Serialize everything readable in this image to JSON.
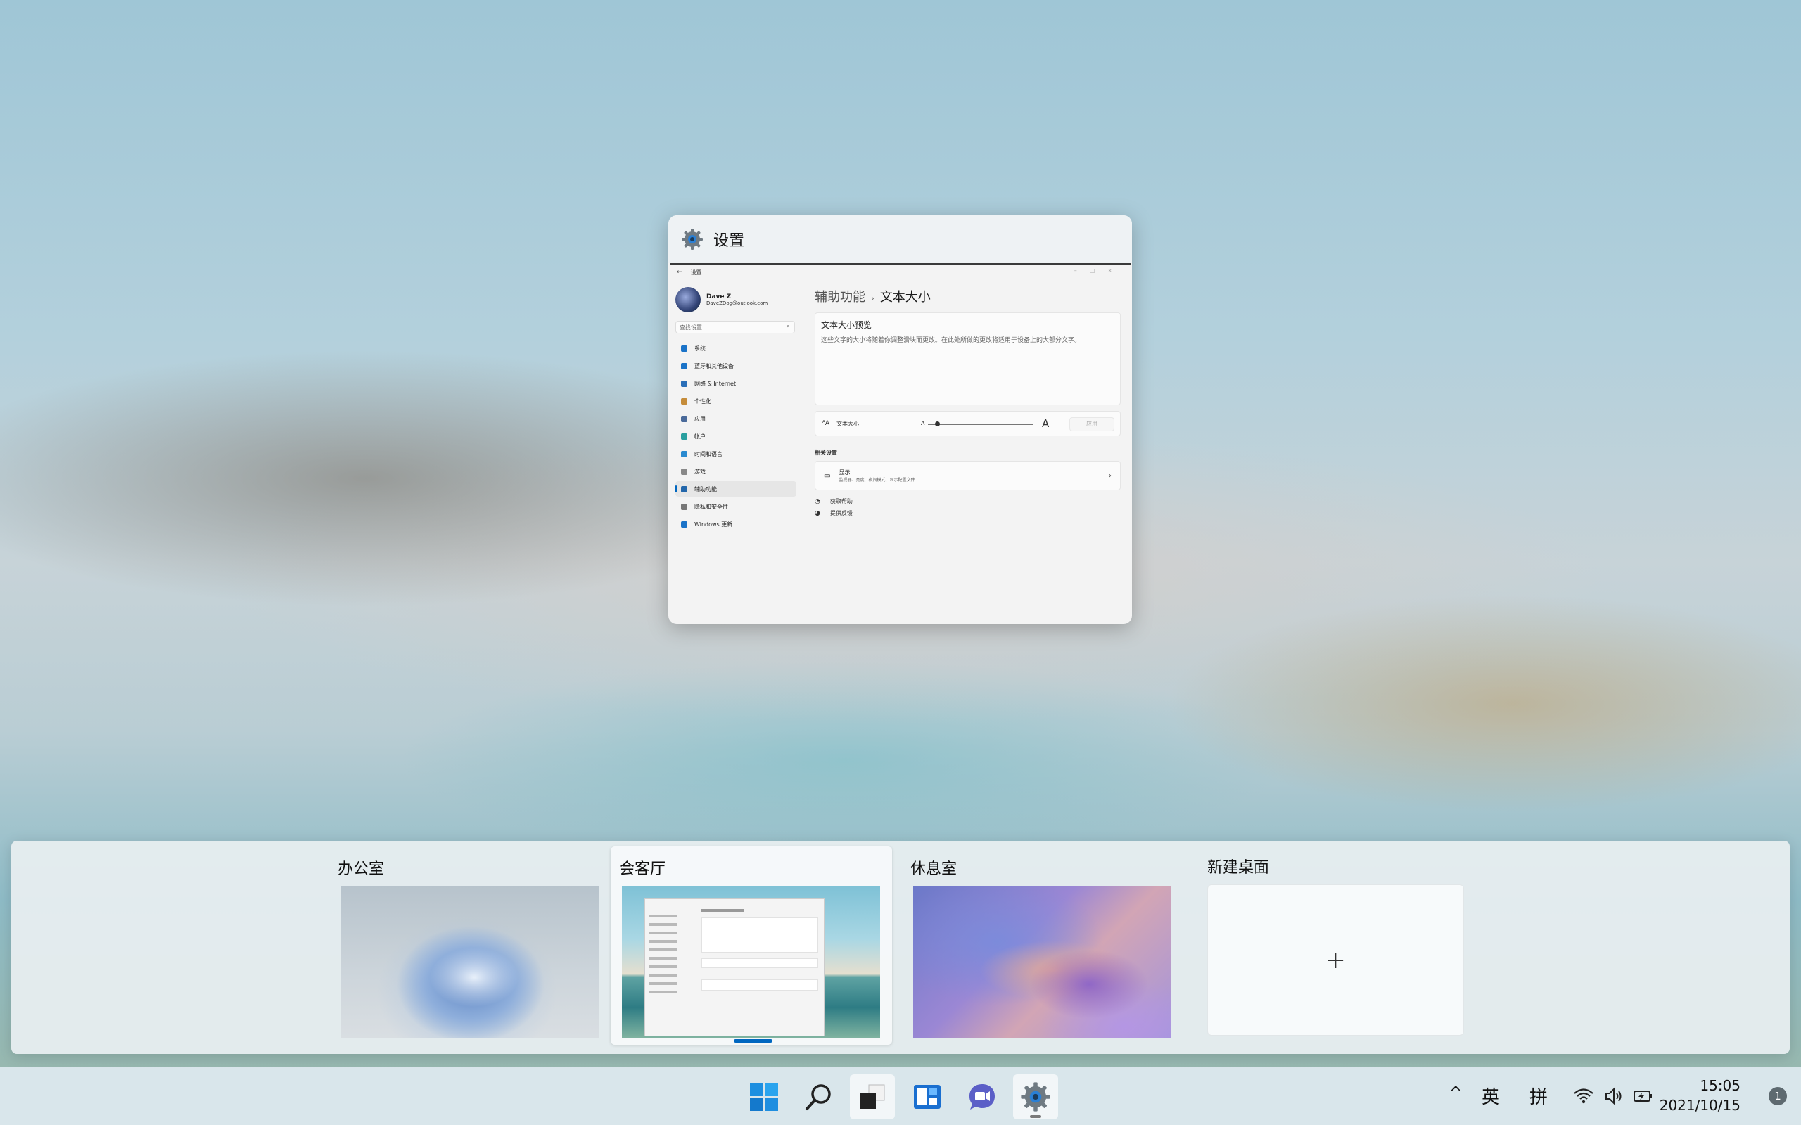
{
  "window_preview": {
    "title": "设置",
    "inner_title": "设置",
    "profile": {
      "name": "Dave Z",
      "email": "DaveZDog@outlook.com"
    },
    "search_placeholder": "查找设置",
    "nav": [
      {
        "label": "系统",
        "color": "#1a73c8"
      },
      {
        "label": "蓝牙和其他设备",
        "color": "#1a73c8"
      },
      {
        "label": "网络 & Internet",
        "color": "#2a6fb8"
      },
      {
        "label": "个性化",
        "color": "#c58c3a"
      },
      {
        "label": "应用",
        "color": "#4a6a9a"
      },
      {
        "label": "帐户",
        "color": "#2aa0a0"
      },
      {
        "label": "时间和语言",
        "color": "#2a8ad0"
      },
      {
        "label": "游戏",
        "color": "#888888"
      },
      {
        "label": "辅助功能",
        "color": "#2266aa"
      },
      {
        "label": "隐私和安全性",
        "color": "#777777"
      },
      {
        "label": "Windows 更新",
        "color": "#1a73c8"
      }
    ],
    "active_nav": "辅助功能",
    "breadcrumb_parent": "辅助功能",
    "breadcrumb_sep": "›",
    "breadcrumb_current": "文本大小",
    "preview_title": "文本大小预览",
    "preview_body": "这些文字的大小将随着你调整滑块而更改。在此处所做的更改将适用于设备上的大部分文字。",
    "text_size_label": "文本大小",
    "slider_small": "A",
    "slider_big": "A",
    "text_size_fraction": 0.07,
    "apply_label": "应用",
    "related_label": "相关设置",
    "display_title": "显示",
    "display_sub": "监视器、亮度、夜间模式、显示配置文件",
    "help_links": [
      "获取帮助",
      "提供反馈"
    ]
  },
  "desktops": [
    {
      "label": "办公室",
      "active": false
    },
    {
      "label": "会客厅",
      "active": true
    },
    {
      "label": "休息室",
      "active": false
    }
  ],
  "new_desktop": {
    "label": "新建桌面",
    "plus": "+"
  },
  "taskbar": {
    "apps": [
      "start-icon",
      "search-icon",
      "task-view-icon",
      "widgets-icon",
      "teams-chat-icon",
      "settings-icon"
    ],
    "tray": {
      "chevron": "^",
      "ime_lang": "英",
      "ime_mode": "拼",
      "time": "15:05",
      "date": "2021/10/15",
      "notification_count": "1"
    }
  },
  "colors": {
    "accent": "#0067c0"
  }
}
